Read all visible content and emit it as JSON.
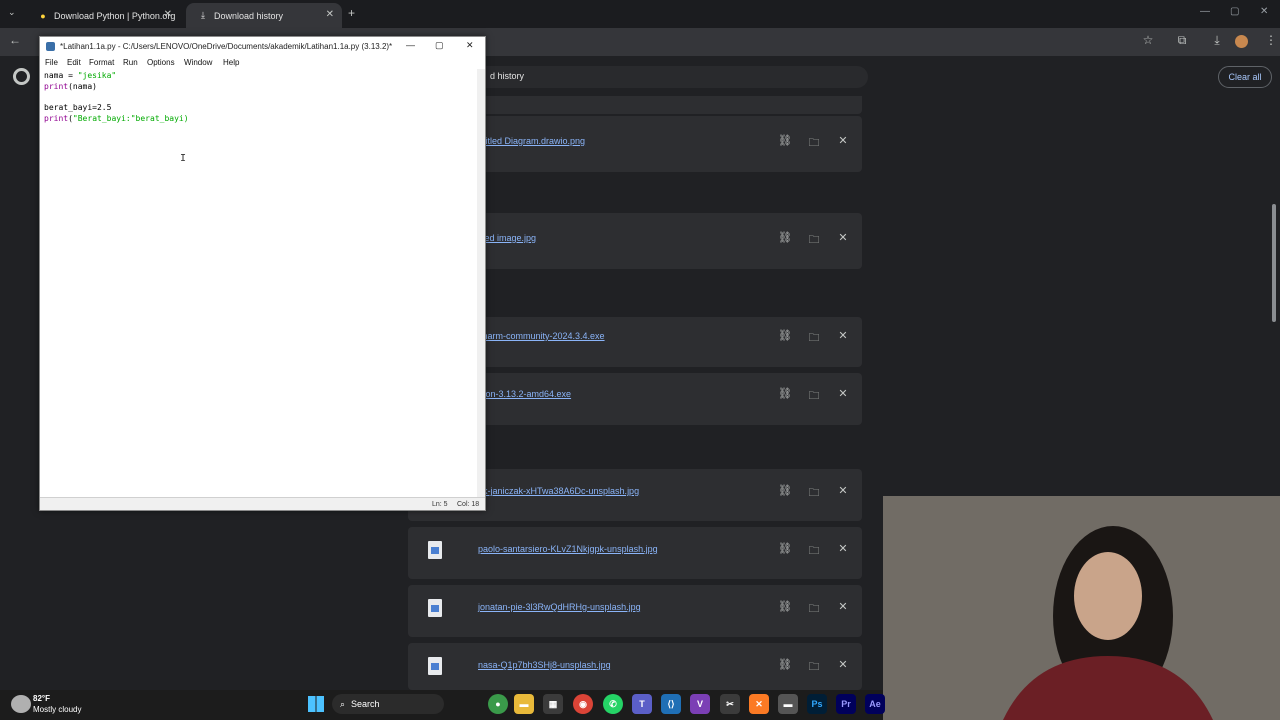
{
  "browser": {
    "tabs": [
      {
        "label": "Download Python | Python.org",
        "active": false
      },
      {
        "label": "Download history",
        "active": true
      }
    ]
  },
  "downloads": {
    "header": "d history",
    "clear_all": "Clear all",
    "files": [
      "ntitled Diagram.drawio.png",
      "itled image.jpg",
      "charm-community-2024.3.4.exe",
      "thon-3.13.2-amd64.exe",
      "ek-janiczak-xHTwa38A6Dc-unsplash.jpg",
      "paolo-santarsiero-KLvZ1Nkjgpk-unsplash.jpg",
      "jonatan-pie-3l3RwQdHRHg-unsplash.jpg",
      "nasa-Q1p7bh3SHj8-unsplash.jpg"
    ]
  },
  "idle": {
    "title": "*Latihan1.1a.py - C:/Users/LENOVO/OneDrive/Documents/akademik/Latihan1.1a.py (3.13.2)*",
    "menu": [
      "File",
      "Edit",
      "Format",
      "Run",
      "Options",
      "Window",
      "Help"
    ],
    "code": {
      "l1_a": "nama = ",
      "l1_s": "\"jesika\"",
      "l2_k": "print",
      "l2_r": "(nama)",
      "l4": "berat_bayi=2.5",
      "l5_k": "print",
      "l5_p": "(",
      "l5_s": "\"Berat_bayi:\"",
      "l5_r": "berat_bayi)"
    },
    "status_ln": "Ln: 5",
    "status_col": "Col: 18"
  },
  "weather": {
    "temp": "82°F",
    "desc": "Mostly cloudy"
  },
  "taskbar": {
    "search": "Search"
  },
  "colors": {
    "link": "#8ab4f8",
    "card": "#2d2e31",
    "bg": "#202124"
  }
}
